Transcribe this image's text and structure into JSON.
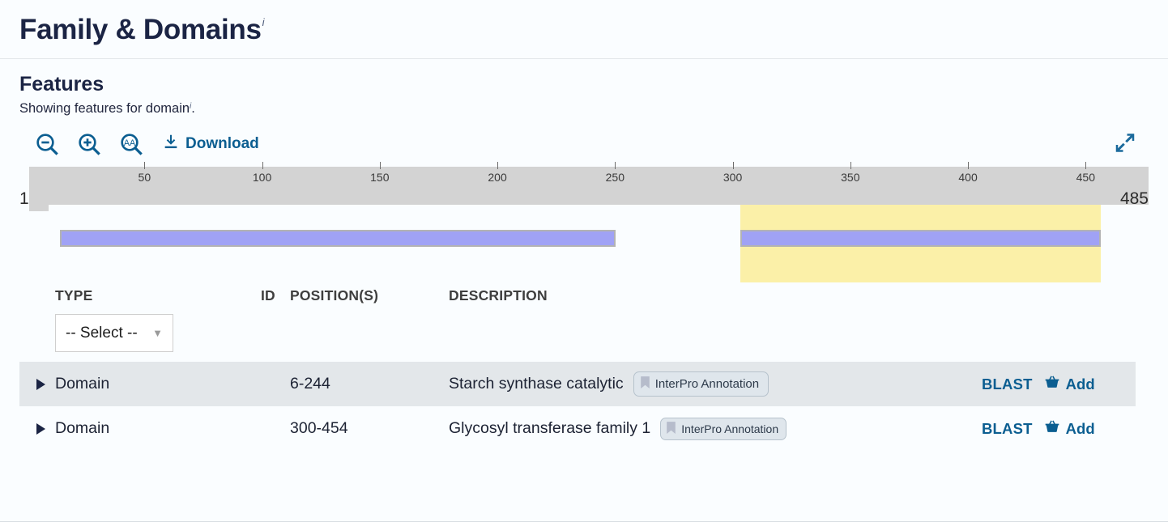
{
  "header": {
    "title": "Family & Domains",
    "info_marker": "i"
  },
  "features": {
    "title": "Features",
    "subtitle_prefix": "Showing features for domain",
    "subtitle_marker": "i",
    "subtitle_suffix": "."
  },
  "toolbar": {
    "zoom_out": "zoom-out-icon",
    "zoom_in": "zoom-in-icon",
    "zoom_aa": "zoom-amino-acid-icon",
    "download_label": "Download",
    "download_icon": "download-icon",
    "expand_icon": "expand-fullscreen-icon"
  },
  "ruler": {
    "start_label": "1",
    "end_label": "485",
    "sequence_length": 485,
    "ticks": [
      50,
      100,
      150,
      200,
      250,
      300,
      350,
      400,
      450
    ]
  },
  "tracks": {
    "highlight": {
      "start": 300,
      "end": 454,
      "color": "#fbf0a8"
    },
    "bars": [
      {
        "name": "Starch synthase catalytic",
        "start": 6,
        "end": 244,
        "color": "#a0a2f5"
      },
      {
        "name": "Glycosyl transferase family 1",
        "start": 300,
        "end": 454,
        "color": "#a0a2f5"
      }
    ]
  },
  "table": {
    "columns": {
      "type": "TYPE",
      "id": "ID",
      "positions": "POSITION(S)",
      "description": "DESCRIPTION"
    },
    "type_filter": {
      "value": "-- Select --",
      "caret": "chevron-down-icon"
    },
    "rows": [
      {
        "type": "Domain",
        "id": "",
        "positions": "6-244",
        "description": "Starch synthase catalytic",
        "badge": "InterPro Annotation",
        "blast": "BLAST",
        "add": "Add"
      },
      {
        "type": "Domain",
        "id": "",
        "positions": "300-454",
        "description": "Glycosyl transferase family 1",
        "badge": "InterPro Annotation",
        "blast": "BLAST",
        "add": "Add"
      }
    ]
  },
  "colors": {
    "link": "#0b5e91",
    "title": "#1b2444",
    "ruler": "#d3d3d3",
    "bar": "#a0a2f5",
    "highlight": "#fbf0a8",
    "row_highlight": "#e3e7ea"
  }
}
